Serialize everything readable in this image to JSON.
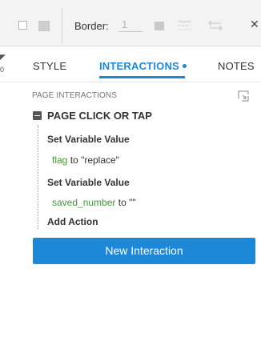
{
  "toolbar": {
    "border_label": "Border:",
    "border_value": "1",
    "close_glyph": "✕"
  },
  "left_edge": {
    "glyph": "◤",
    "zero": "0"
  },
  "tabs": {
    "style": "STYLE",
    "interactions": "INTERACTIONS",
    "notes": "NOTES"
  },
  "panel": {
    "section_label": "PAGE INTERACTIONS",
    "event_label": "PAGE CLICK OR TAP",
    "actions": [
      {
        "title": "Set Variable Value",
        "variable": "flag",
        "connector": "to",
        "value": "\"replace\""
      },
      {
        "title": "Set Variable Value",
        "variable": "saved_number",
        "connector": "to",
        "value": "\"\""
      }
    ],
    "add_action": "Add Action",
    "new_interaction": "New Interaction"
  },
  "colors": {
    "accent": "#1e88d8",
    "variable": "#3a9c2f",
    "toolbar_bg": "#f3f3f3"
  },
  "icons": {
    "stroke_outline": "square-outline-icon",
    "fill_swatch": "square-filled-icon",
    "line_style": "line-style-icon",
    "arrow_style": "arrow-style-icon",
    "close": "close-icon",
    "collapse": "collapse-icon",
    "section": "organize-icon"
  }
}
